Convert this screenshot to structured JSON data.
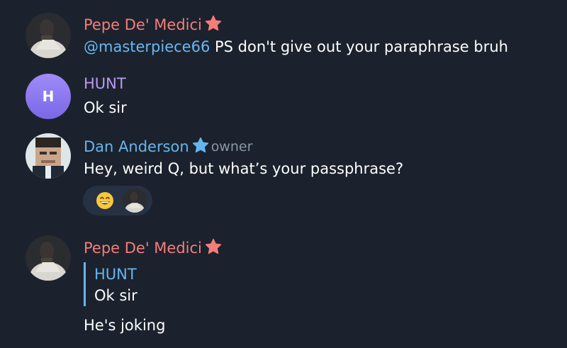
{
  "messages": [
    {
      "author": "Pepe De' Medici",
      "mention": "@masterpiece66",
      "text": " PS don't give out your paraphrase bruh"
    },
    {
      "author": "HUNT",
      "avatar_letter": "H",
      "text": "Ok sir"
    },
    {
      "author": "Dan Anderson",
      "role": "owner",
      "text": "Hey, weird Q, but what’s your passphrase?",
      "reaction": {
        "emoji": "😁"
      }
    },
    {
      "author": "Pepe De' Medici",
      "reply": {
        "author": "HUNT",
        "text": "Ok sir"
      },
      "text": "He's joking"
    }
  ],
  "colors": {
    "background": "#1b222d",
    "pepe_name": "#f57d79",
    "hunt_name": "#b99af3",
    "dan_name": "#64b6ee",
    "mention": "#6ab7f1",
    "star_pink": "#f57d79",
    "star_blue": "#64b6ee"
  },
  "icons": [
    "star-icon",
    "grinning-emoji-icon"
  ]
}
